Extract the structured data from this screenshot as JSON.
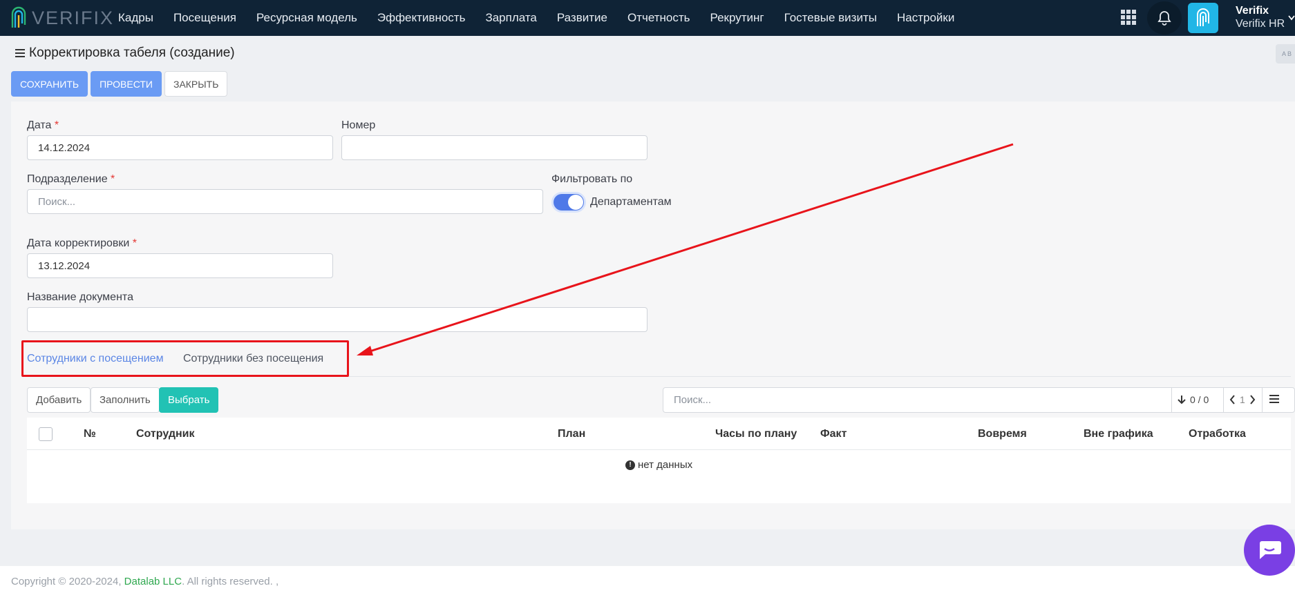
{
  "header": {
    "logo_text": "VERIFIX",
    "nav": [
      "Кадры",
      "Посещения",
      "Ресурсная модель",
      "Эффективность",
      "Зарплата",
      "Развитие",
      "Отчетность",
      "Рекрутинг",
      "Гостевые визиты",
      "Настройки"
    ],
    "user_name": "Verifix",
    "company": "Verifix HR"
  },
  "page": {
    "title": "Корректировка табеля (создание)",
    "corner_label": "A B"
  },
  "actions": {
    "save": "СОХРАНИТЬ",
    "post": "ПРОВЕСТИ",
    "close": "ЗАКРЫТЬ"
  },
  "form": {
    "date_label": "Дата",
    "date_value": "14.12.2024",
    "number_label": "Номер",
    "number_value": "",
    "division_label": "Подразделение",
    "division_placeholder": "Поиск...",
    "filter_label": "Фильтровать по",
    "filter_option": "Департаментам",
    "correction_date_label": "Дата корректировки",
    "correction_date_value": "13.12.2024",
    "doc_name_label": "Название документа",
    "doc_name_value": "",
    "required_mark": "*"
  },
  "tabs": [
    "Сотрудники с посещением",
    "Сотрудники без посещения"
  ],
  "toolbar": {
    "add": "Добавить",
    "fill": "Заполнить",
    "select": "Выбрать",
    "search_placeholder": "Поиск...",
    "counter": "0 / 0",
    "page": "1"
  },
  "table": {
    "columns": [
      "№",
      "Сотрудник",
      "План",
      "Часы по плану",
      "Факт",
      "Вовремя",
      "Вне графика",
      "Отработка"
    ],
    "empty_text": "нет данных"
  },
  "footer": {
    "copyright": "Copyright © 2020-2024,",
    "company_link": "Datalab LLC",
    "rights": ". All rights reserved. ,"
  },
  "colors": {
    "topbar": "#0f2336",
    "primary": "#6a9bf4",
    "teal": "#22c2b4",
    "annotation": "#e8141b",
    "chat": "#7a3fe4"
  }
}
